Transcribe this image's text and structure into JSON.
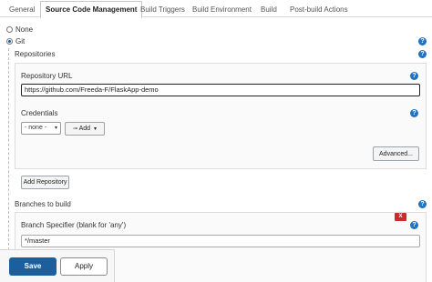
{
  "tabs": [
    {
      "label": "General",
      "active": false
    },
    {
      "label": "Source Code Management",
      "active": true
    },
    {
      "label": "Build Triggers",
      "active": false
    },
    {
      "label": "Build Environment",
      "active": false
    },
    {
      "label": "Build",
      "active": false
    },
    {
      "label": "Post-build Actions",
      "active": false
    }
  ],
  "scm": {
    "options": [
      {
        "label": "None",
        "selected": false
      },
      {
        "label": "Git",
        "selected": true
      }
    ],
    "help_glyph": "?"
  },
  "repositories": {
    "title": "Repositories",
    "url_label": "Repository URL",
    "url_value": "https://github.com/Freeda-F/FlaskApp-demo",
    "credentials_label": "Credentials",
    "credentials_selected": "- none -",
    "add_label": "Add",
    "advanced_label": "Advanced...",
    "add_repository_label": "Add Repository"
  },
  "branches": {
    "title": "Branches to build",
    "delete_label": "X",
    "specifier_label": "Branch Specifier (blank for 'any')",
    "specifier_value": "*/master"
  },
  "actions": {
    "save_label": "Save",
    "apply_label": "Apply"
  },
  "colors": {
    "accent": "#1d5f9c",
    "help": "#1f72c4",
    "danger": "#cc2b2b"
  },
  "icons": [
    "help-icon",
    "key-icon",
    "caret-down-icon",
    "delete-icon"
  ]
}
